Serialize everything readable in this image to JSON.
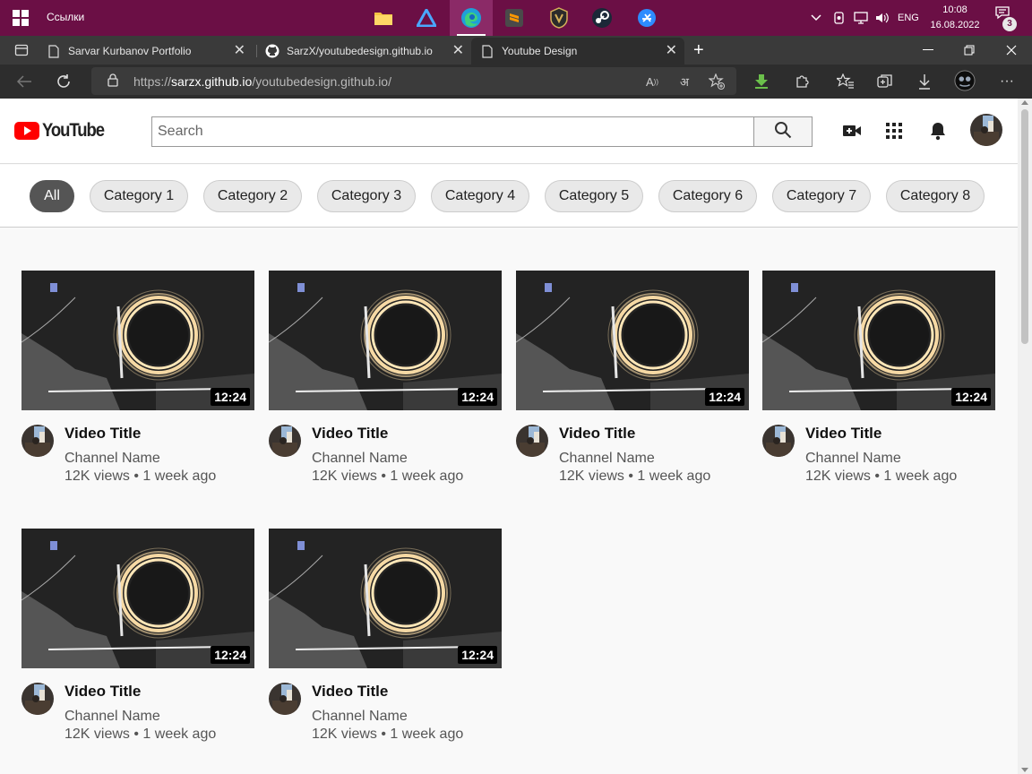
{
  "taskbar": {
    "links_label": "Ссылки",
    "tray_lang": "ENG",
    "time": "10:08",
    "date": "16.08.2022",
    "notification_count": "3"
  },
  "tabs": [
    {
      "label": "Sarvar Kurbanov Portfolio",
      "favicon": "page-icon"
    },
    {
      "label": "SarzX/youtubedesign.github.io",
      "favicon": "github-icon"
    },
    {
      "label": "Youtube Design",
      "favicon": "page-icon"
    }
  ],
  "addressbar": {
    "url_prefix": "https://",
    "url_host": "sarzx.github.io",
    "url_path": "/youtubedesign.github.io/"
  },
  "header": {
    "logo_text": "YouTube",
    "search_placeholder": "Search"
  },
  "categories": [
    "All",
    "Category 1",
    "Category 2",
    "Category 3",
    "Category 4",
    "Category 5",
    "Category 6",
    "Category 7",
    "Category 8"
  ],
  "videos": [
    {
      "title": "Video Title",
      "channel": "Channel Name",
      "meta": "12K views • 1 week ago",
      "duration": "12:24"
    },
    {
      "title": "Video Title",
      "channel": "Channel Name",
      "meta": "12K views • 1 week ago",
      "duration": "12:24"
    },
    {
      "title": "Video Title",
      "channel": "Channel Name",
      "meta": "12K views • 1 week ago",
      "duration": "12:24"
    },
    {
      "title": "Video Title",
      "channel": "Channel Name",
      "meta": "12K views • 1 week ago",
      "duration": "12:24"
    },
    {
      "title": "Video Title",
      "channel": "Channel Name",
      "meta": "12K views • 1 week ago",
      "duration": "12:24"
    },
    {
      "title": "Video Title",
      "channel": "Channel Name",
      "meta": "12K views • 1 week ago",
      "duration": "12:24"
    }
  ],
  "colors": {
    "taskbar": "#6b0f45",
    "youtube_red": "#ff0000",
    "active_chip": "#555555"
  }
}
